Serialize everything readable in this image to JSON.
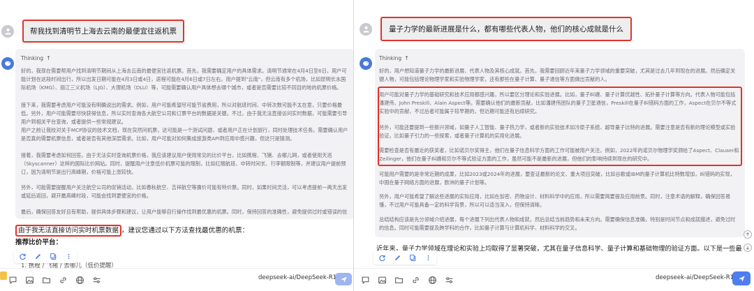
{
  "left": {
    "question": "帮我找到清明节上海去云南的最便宜往返机票",
    "thinking_label": "Thinking",
    "paragraphs": [
      "好的，我现在需要帮用户找到清明节期间从上海去云南的最便宜往返机票。首先，我需要确定用户的具体需求。清明节通常在4月4日至6日，用户可能计划在这段时间出行，所以出发日期可能在4月3日或4日，返程可能在4月6日或7日左右。用户提到\"云南\"，但云南有多个机场，比如昆明长水国际机场（KMG）、丽江三义机场（LJG）、大理机场（DLU）等，可能需要确认用户具体想去哪个城市，或者是否需要比较不同目的地的机票价格。",
      "接下来，我需要考虑用户可能没有明确说出的需求。例如，用户可能希望尽可能节省费用，所以对航班时间、中转次数可能不太在意，只要价格最低。另外，用户可能需要尽快获得信息，所以实时查询各大航空公司和订票平台的数据是关键。不过，由于我无法直接访问实时数据，可能需要引导用户到相关平台查询，或者提供一些常规建议。",
      "用户之前让我校对关于MCP协议的技术文档，现在突然问机票，这可能是一个测试问题，或者用户正在计划旅行，同时处理技术任务。需要确认用户是否真的需要机票信息，或者是否有其他深层需求。比如，用户可能对如何集成旅游类API到应用中感兴趣，但这只是猜测。",
      "接着，我需要考虑如何回答。由于无法实时查询机票价格，我应该建议用户使用常见的比价平台，比如携程、飞猪、去哪儿网，或者使用天巡（Skyscanner）这样的国际比价网站。同时，提醒用户注意低价机票可能的限制，比如红眼航班、中转时间长、行李额限制等，并建议用户提前预订，因为清明节是出行高峰期，价格可能上涨较快。",
      "另外，可能需要提醒用户关注航空公司的促销活动，比如春秋航空、吉祥航空等廉价可能有特价票。同时，如果时间灵活，可以考虑提前一两天出发或延后返回，避开最高峰时段，可能会找到更便宜的价格。",
      "最后，确保回答友好且有帮助，提供具体步骤和建议，让用户能够自行操作找到最优惠的机票。同时，保持回答的准确性，避免提供过时或错误的信息。"
    ],
    "answer_line1_highlight": "由于我无法直接访问实时机票数据",
    "answer_line1_rest": "，建议您通过以下方法查找最优惠的机票：",
    "answer_line2": "推荐比价平台：",
    "answer_line3": "1. 携程 / 飞猪 / 去哪儿（低价提醒）",
    "model_name": "deepseek-ai/DeepSeek-R1"
  },
  "right": {
    "question": "量子力学的最新进展是什么，都有哪些代表人物，他们的核心成就是什么",
    "thinking_label": "Thinking",
    "paragraphs": [
      "好的，用户想知道量子力学的最新进展、代表人物及其核心成就。首先，我需要回顾近年来量子力学领域的重要突破，尤其是过去几年到现在的进展。然后确定关键人物，可能包括理论物理学家和实验物理学家，还有那些在量子计算、量子通信等方面做出贡献的人。",
      "用户可能对量子力学的基础研究和技术应用都感兴趣，所以要区分理论和实验进展。比如，量子纠缠、量子计算优越性、拓扑量子计算等方向。代表人物可能包括潘建伟、John Preskill、Alain Aspect等。需要确认他们的最新贡献，比如潘建伟团队的量子卫星通信，Preskill在量子纠错码方面的工作，Aspect在贝尔不等式实验中的贡献，不过后者可能属于较早期的，但近期可能还有后续研究。",
      "另外，可能还要提到一些新兴领域，如量子人工智能、量子热力学，或者新的实验技术如冷原子系统、超导量子比特的进展。需要注意是否有新的理论模型或实验验证，比如量子引力的一些探索，或者量子计算机的实用化进展。",
      "需要检查是否有最近的获奖者，比如诺贝尔奖得主，他们在量子信息科学方面的工作可能被用户关注。例如，2022年的诺贝尔物理学奖颁给了Aspect、Clauser和Zeilinger，他们在量子纠缠和贝尔不等式验证方面的工作，虽然可能不是最新的进展，但他们的影响持续到现在的研究中。",
      "可能用户需要的是非常近期的成果，比如2023或2024年的进展，要查证最新的论文、重大项目突破，比如谷歌或IBM的量子计算机比特数增加，纠错码的实现，中国在量子网络方面的进展，欧洲的量子计划等。",
      "另外，用户可能希望了解这些进展的实际应用，比如在加密、药物设计、材料科学中的应用，所以需要简要提及应用前景。同时，注意术语的解释，确保回答易懂，不过用户可能具备一定的科学背景，所以可以适当深入，但保持清晰。",
      "总结结构应该是先分领域介绍进展，每个进展下列出代表人物和成就，然后总结当前趋势和未来方向。需要确保信息准确，特别是时间节点和成就描述，避免过时的信息。同时可能需要提及跨学科的合作，比如量子计算与计算机科学、材料科学的交叉。"
    ],
    "answer_line1": "近年来，量子力学领域在理论和实验上均取得了显著突破，尤其在量子信息科学、量子计算和基础物理的验证方面。以下是一些最",
    "model_name": "deepseek-ai/DeepSeek-R1"
  },
  "colors": {
    "highlight": "#e0322a",
    "bot_avatar": "#4a78d8",
    "send_active": "#4f7ef0",
    "send_inactive": "#9db6f2"
  }
}
